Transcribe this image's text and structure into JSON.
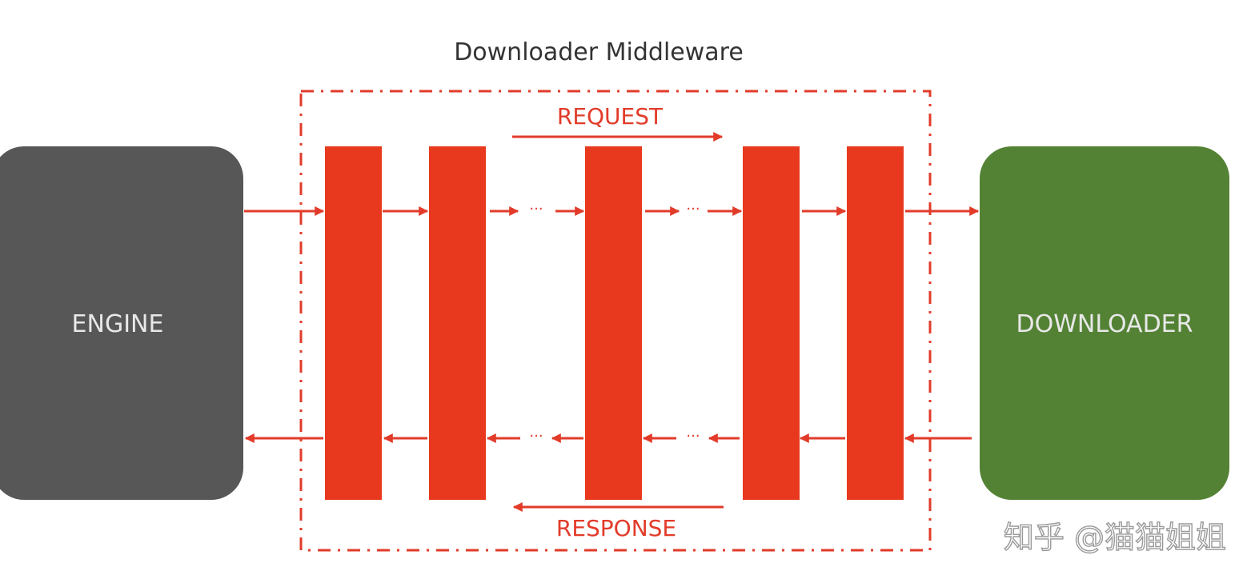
{
  "title": "Downloader Middleware",
  "engine": {
    "label": "ENGINE",
    "color": "#585758"
  },
  "downloader": {
    "label": "DOWNLOADER",
    "color": "#548235"
  },
  "request_label": "REQUEST",
  "response_label": "RESPONSE",
  "middleware_color": "#e8391f",
  "arrow_color": "#e23b2a",
  "ellipsis": "···",
  "watermark": "知乎 @猫猫姐姐"
}
